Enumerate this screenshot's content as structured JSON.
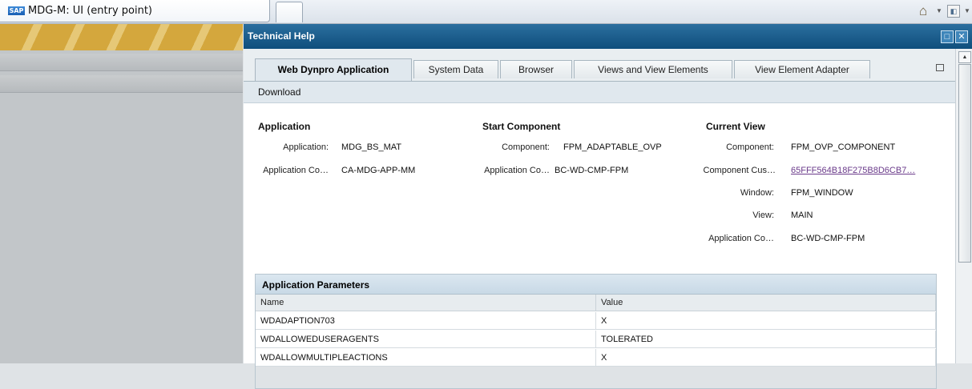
{
  "browser": {
    "tab_title": "MDG-M: UI (entry point)",
    "logo_text": "SAP"
  },
  "window": {
    "title": "Technical Help"
  },
  "tabs": [
    {
      "label": "Web Dynpro Application",
      "active": true
    },
    {
      "label": "System Data",
      "active": false
    },
    {
      "label": "Browser",
      "active": false
    },
    {
      "label": "Views and View Elements",
      "active": false
    },
    {
      "label": "View Element Adapter",
      "active": false
    }
  ],
  "toolbar": {
    "download_label": "Download"
  },
  "application": {
    "title": "Application",
    "application_label": "Application:",
    "application_value": "MDG_BS_MAT",
    "app_comp_label": "Application Co…",
    "app_comp_value": "CA-MDG-APP-MM"
  },
  "start_component": {
    "title": "Start Component",
    "component_label": "Component:",
    "component_value": "FPM_ADAPTABLE_OVP",
    "app_comp_label": "Application Co…",
    "app_comp_value": "BC-WD-CMP-FPM"
  },
  "current_view": {
    "title": "Current View",
    "component_label": "Component:",
    "component_value": "FPM_OVP_COMPONENT",
    "comp_cus_label": "Component Cus…",
    "comp_cus_value": "65FFF564B18F275B8D6CB7…",
    "window_label": "Window:",
    "window_value": "FPM_WINDOW",
    "view_label": "View:",
    "view_value": "MAIN",
    "app_comp_label": "Application Co…",
    "app_comp_value": "BC-WD-CMP-FPM"
  },
  "params": {
    "title": "Application Parameters",
    "col_name": "Name",
    "col_value": "Value",
    "rows": [
      {
        "name": "WDADAPTION703",
        "value": "X"
      },
      {
        "name": "WDALLOWEDUSERAGENTS",
        "value": "TOLERATED"
      },
      {
        "name": "WDALLOWMULTIPLEACTIONS",
        "value": "X"
      }
    ]
  },
  "icons": {
    "home": "⌂",
    "feed": "◧",
    "dropdown": "▼",
    "maximize": "□",
    "close": "✕",
    "scroll_up": "▲"
  }
}
